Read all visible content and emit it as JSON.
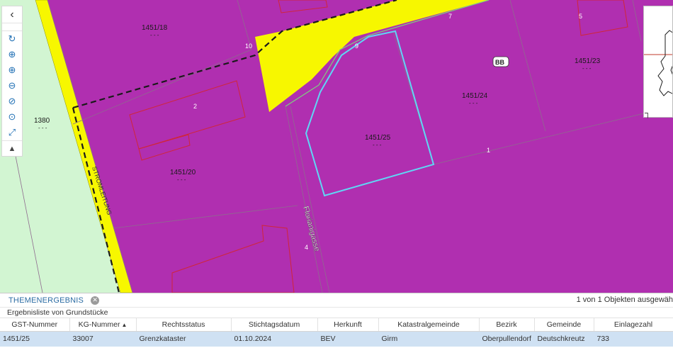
{
  "map": {
    "parcel_labels": [
      "1451/18",
      "1451/20",
      "1451/23",
      "1451/24",
      "1451/25",
      "1380"
    ],
    "number_labels": [
      "10",
      "9",
      "7",
      "5",
      "2",
      "1",
      "4"
    ],
    "street_labels": [
      "STROMLEITUNG",
      "Florianigasse"
    ],
    "zone_badge": "BB",
    "dash_placeholder": "- - -",
    "colors": {
      "parcel_fill": "#b02fb0",
      "road_yellow": "#f7f700",
      "green_area": "#d2f5d2",
      "selection_outline": "#5fd7f5",
      "building_outline": "#d0263a"
    }
  },
  "toolbar": {
    "icons": [
      "chevron-left-icon",
      "refresh-icon",
      "globe-icon",
      "zoom-in-icon",
      "zoom-out-icon",
      "zoom-previous-icon",
      "zoom-next-icon",
      "full-extent-icon",
      "chevron-up-icon"
    ]
  },
  "results": {
    "tab_label": "THEMENERGEBNIS",
    "count_text": "1 von 1 Objekten ausgewäh",
    "subtitle": "Ergebnisliste von Grundstücke",
    "columns": [
      "GST-Nummer",
      "KG-Nummer",
      "Rechtsstatus",
      "Stichtagsdatum",
      "Herkunft",
      "Katastralgemeinde",
      "Bezirk",
      "Gemeinde",
      "Einlagezahl"
    ],
    "sorted_column_indicator": "▲",
    "rows": [
      [
        "1451/25",
        "33007",
        "Grenzkataster",
        "01.10.2024",
        "BEV",
        "Girm",
        "Oberpullendorf",
        "Deutschkreutz",
        "733"
      ]
    ]
  }
}
